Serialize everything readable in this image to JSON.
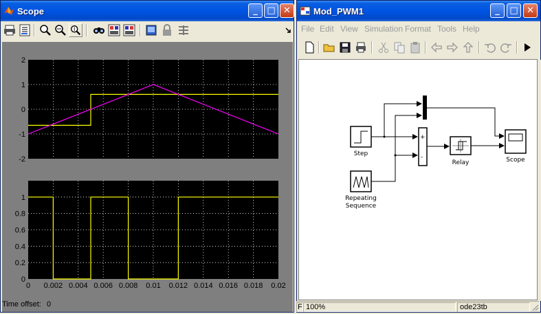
{
  "scope_window": {
    "title": "Scope",
    "toolbar_icons": [
      "print-icon",
      "parameters-icon",
      "zoom-icon",
      "zoom-x-icon",
      "zoom-y-icon",
      "autoscale-icon",
      "save-axes-icon",
      "restore-axes-icon",
      "floating-scope-icon",
      "lock-icon",
      "signal-selection-icon"
    ],
    "time_offset_label": "Time offset:",
    "time_offset_value": "0"
  },
  "chart_data": [
    {
      "type": "line",
      "ylim": [
        -2,
        2
      ],
      "xlim": [
        0,
        0.02
      ],
      "yticks": [
        "2",
        "1",
        "0",
        "-1",
        "-2"
      ],
      "grid": true,
      "series": [
        {
          "color": "#ffff00",
          "x": [
            0,
            0.005,
            0.005,
            0.02
          ],
          "y": [
            -0.65,
            -0.65,
            0.6,
            0.6
          ]
        },
        {
          "color": "#ff00ff",
          "x": [
            0,
            0.01,
            0.02
          ],
          "y": [
            -1,
            1,
            -1
          ]
        }
      ]
    },
    {
      "type": "line",
      "ylim": [
        0,
        1.2
      ],
      "xlim": [
        0,
        0.02
      ],
      "yticks": [
        "1",
        "0.8",
        "0.6",
        "0.4",
        "0.2",
        "0"
      ],
      "xticks": [
        "0",
        "0.002",
        "0.004",
        "0.006",
        "0.008",
        "0.01",
        "0.012",
        "0.014",
        "0.016",
        "0.018",
        "0.02"
      ],
      "grid": true,
      "series": [
        {
          "color": "#ffff00",
          "x": [
            0,
            0.002,
            0.002,
            0.005,
            0.005,
            0.008,
            0.008,
            0.012,
            0.012,
            0.02
          ],
          "y": [
            1,
            1,
            0,
            0,
            1,
            1,
            0,
            0,
            1,
            1
          ]
        }
      ]
    }
  ],
  "model_window": {
    "title": "Mod_PWM1",
    "menu": [
      "File",
      "Edit",
      "View",
      "Simulation",
      "Format",
      "Tools",
      "Help"
    ],
    "toolbar_icons": [
      "new-icon",
      "open-icon",
      "save-icon",
      "print-icon",
      "cut-icon",
      "copy-icon",
      "paste-icon",
      "back-icon",
      "forward-icon",
      "up-icon",
      "undo-icon",
      "redo-icon",
      "run-icon"
    ],
    "blocks": {
      "step": "Step",
      "repeating_line1": "Repeating",
      "repeating_line2": "Sequence",
      "relay": "Relay",
      "scope": "Scope",
      "sum_plus": "+",
      "sum_minus": "-"
    },
    "status": {
      "left": "F",
      "zoom": "100%",
      "solver": "ode23tb"
    }
  }
}
